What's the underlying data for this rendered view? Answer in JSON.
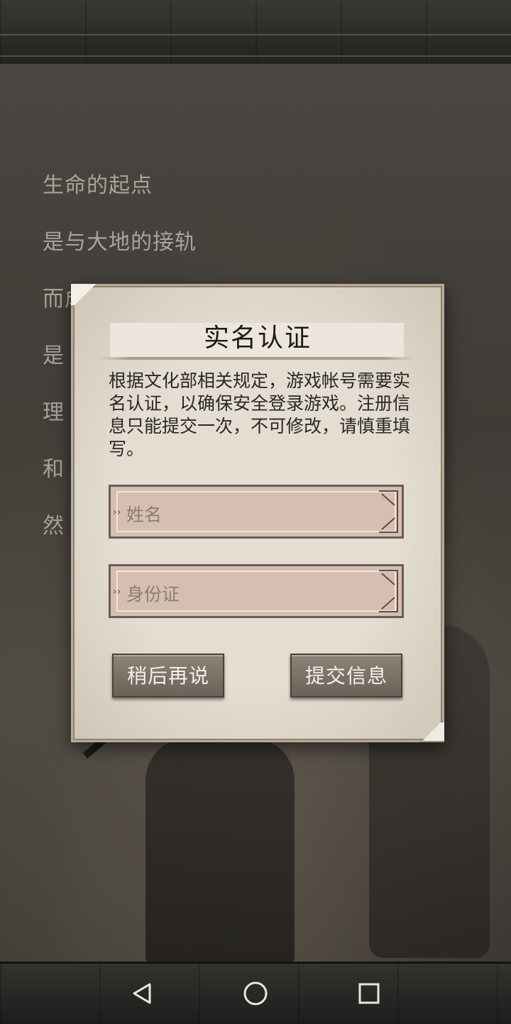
{
  "background_story": [
    "生命的起点",
    "是与大地的接轨",
    "而成",
    "是",
    "理",
    "和",
    "然"
  ],
  "dialog": {
    "title": "实名认证",
    "description": "根据文化部相关规定，游戏帐号需要实名认证，以确保安全登录游戏。注册信息只能提交一次，不可修改，请慎重填写。",
    "name_field": {
      "placeholder": "姓名",
      "value": ""
    },
    "id_field": {
      "placeholder": "身份证",
      "value": ""
    },
    "later_button": "稍后再说",
    "submit_button": "提交信息"
  },
  "nav": {
    "back_icon": "back-triangle-icon",
    "home_icon": "home-circle-icon",
    "recents_icon": "recents-square-icon"
  },
  "colors": {
    "paper": "#e3ddd2",
    "field_fill": "#d6bfb0",
    "button": "#7b7268",
    "story_text": "#a9a39a"
  }
}
